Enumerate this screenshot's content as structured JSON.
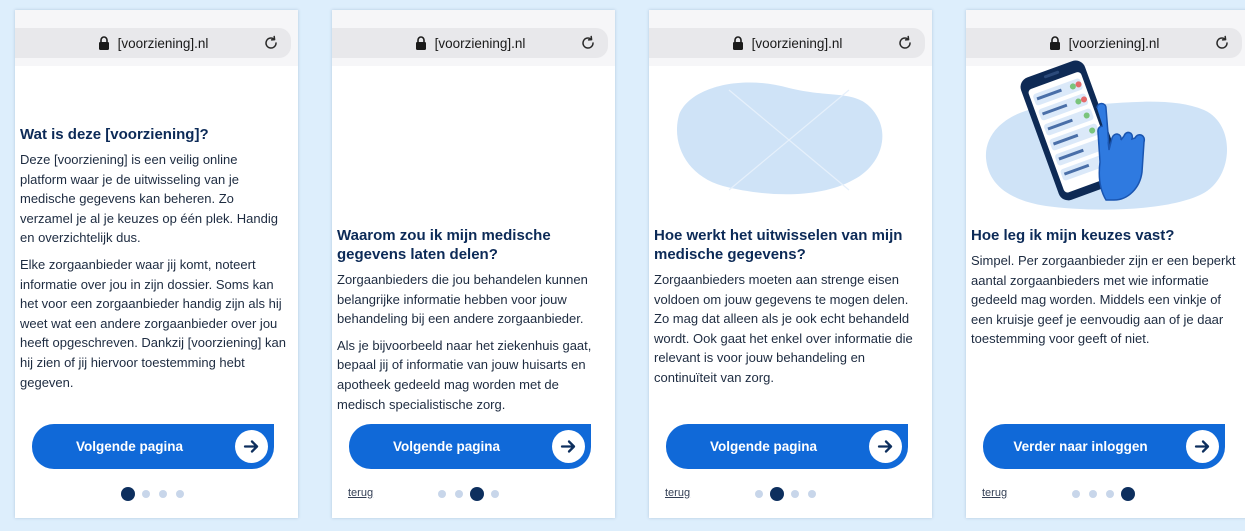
{
  "browser": {
    "url": "[voorziening].nl"
  },
  "screens": [
    {
      "title": "Wat is deze [voorziening]?",
      "paragraphs": [
        "Deze [voorziening] is een veilig online platform waar je de uitwisseling van je medische gegevens kan beheren. Zo verzamel je al je keuzes op één plek. Handig en overzichtelijk dus.",
        "Elke zorgaanbieder waar jij komt, noteert informatie over jou in zijn dossier. Soms kan het voor een zorgaanbieder handig zijn als hij weet wat een andere zorgaanbieder over jou heeft opgeschreven. Dankzij [voorziening] kan hij zien of jij hiervoor toestemming hebt gegeven."
      ],
      "button": "Volgende pagina",
      "back": "",
      "active_dot": 0
    },
    {
      "title": "Waarom zou ik mijn medische gegevens laten delen?",
      "paragraphs": [
        "Zorgaanbieders die jou behandelen kunnen belangrijke informatie hebben voor jouw behandeling bij een andere zorgaanbieder.",
        "Als je bijvoorbeeld naar het ziekenhuis gaat, bepaal jij of informatie van jouw huisarts en apotheek gedeeld mag worden met de medisch specialistische zorg."
      ],
      "button": "Volgende pagina",
      "back": "terug",
      "active_dot": 2
    },
    {
      "title": "Hoe werkt het uitwisselen van mijn medische gegevens?",
      "paragraphs": [
        "Zorgaanbieders moeten aan strenge eisen voldoen om jouw gegevens te mogen delen. Zo mag dat alleen als je ook echt behandeld wordt. Ook gaat het enkel over informatie die relevant is voor jouw behandeling en continuïteit van zorg."
      ],
      "button": "Volgende pagina",
      "back": "terug",
      "active_dot": 1
    },
    {
      "title": "Hoe leg ik mijn keuzes vast?",
      "paragraphs": [
        "Simpel. Per zorgaanbieder zijn er een beperkt aantal zorgaanbieders met wie informatie gedeeld mag worden. Middels een vinkje of een kruisje geef je eenvoudig aan of je daar toestemming voor geeft of niet."
      ],
      "button": "Verder naar inloggen",
      "back": "terug",
      "active_dot": 3
    }
  ],
  "colors": {
    "page_background": "#ddeefc",
    "primary_button": "#1069d8",
    "heading": "#0c2a57",
    "dot_active": "#0d2f5e",
    "dot_inactive": "#c8d6ea",
    "illustration_blob": "#cfe3f7"
  },
  "icons": {
    "lock": "lock-icon",
    "reload": "reload-icon",
    "arrow": "arrow-right-icon"
  }
}
